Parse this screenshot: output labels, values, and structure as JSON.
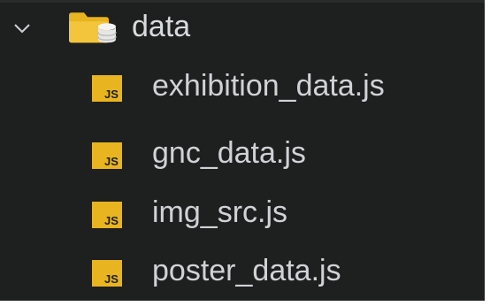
{
  "folder": {
    "name": "data",
    "expanded": true,
    "icon": "folder-database-icon",
    "icon_color": "#e8b41f"
  },
  "files": [
    {
      "name": "exhibition_data.js",
      "icon": "javascript-file-icon"
    },
    {
      "name": "gnc_data.js",
      "icon": "javascript-file-icon"
    },
    {
      "name": "img_src.js",
      "icon": "javascript-file-icon"
    },
    {
      "name": "poster_data.js",
      "icon": "javascript-file-icon"
    }
  ],
  "js_icon_label": "JS",
  "colors": {
    "background": "#1e1f1f",
    "text": "#cfd3d6",
    "js_icon_bg": "#e8b41f",
    "js_icon_text": "#1e1f1f"
  }
}
